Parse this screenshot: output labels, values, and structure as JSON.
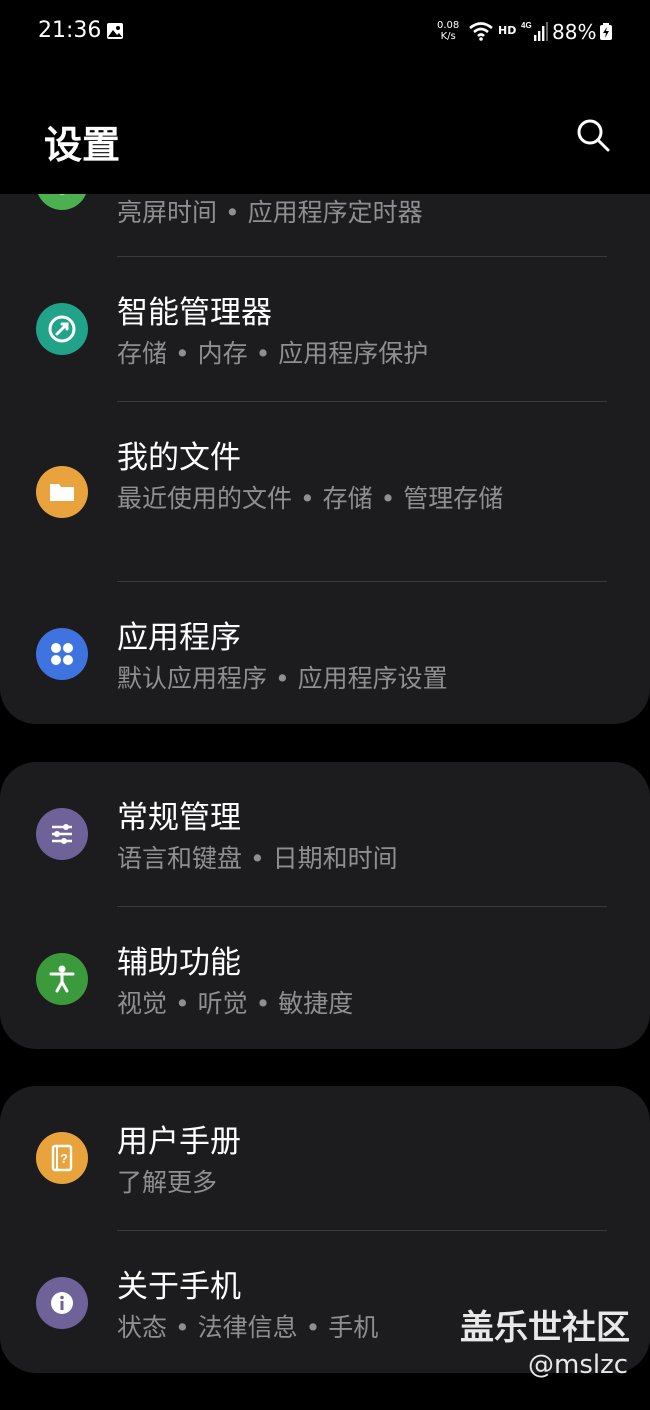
{
  "status_bar": {
    "time": "21:36",
    "net_speed_value": "0.08",
    "net_speed_unit": "K/s",
    "hd": "HD",
    "network": "4G",
    "battery": "88%"
  },
  "header": {
    "title": "设置"
  },
  "groups": [
    {
      "items": [
        {
          "subtitle": "亮屏时间 • 应用程序定时器",
          "icon": "display-icon",
          "color": "#4caf50"
        },
        {
          "title": "智能管理器",
          "subtitle": "存储 • 内存 • 应用程序保护",
          "icon": "device-care-icon",
          "color": "#21a38a"
        },
        {
          "title": "我的文件",
          "subtitle": "最近使用的文件 • 存储 • 管理存储",
          "icon": "folder-icon",
          "color": "#e8a33d"
        },
        {
          "title": "应用程序",
          "subtitle": "默认应用程序 • 应用程序设置",
          "icon": "apps-icon",
          "color": "#3f74e0"
        }
      ]
    },
    {
      "items": [
        {
          "title": "常规管理",
          "subtitle": "语言和键盘 • 日期和时间",
          "icon": "sliders-icon",
          "color": "#6e6298"
        },
        {
          "title": "辅助功能",
          "subtitle": "视觉 • 听觉 • 敏捷度",
          "icon": "accessibility-icon",
          "color": "#3b9a3b"
        }
      ]
    },
    {
      "items": [
        {
          "title": "用户手册",
          "subtitle": "了解更多",
          "icon": "manual-icon",
          "color": "#e8a33d"
        },
        {
          "title": "关于手机",
          "subtitle": "状态 • 法律信息 • 手机",
          "icon": "info-icon",
          "color": "#6e6298"
        }
      ]
    }
  ],
  "watermark": {
    "line1": "盖乐世社区",
    "line2": "@mslzc"
  }
}
